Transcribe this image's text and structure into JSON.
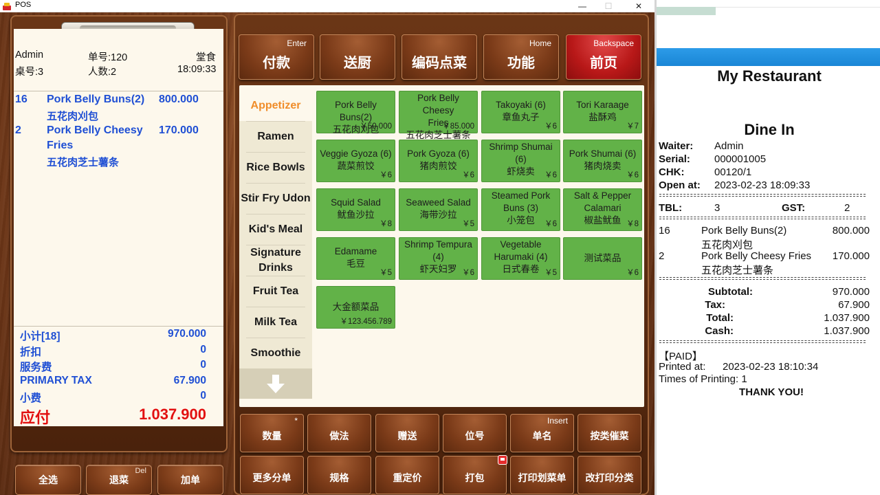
{
  "window": {
    "title": "POS",
    "minimize": "—",
    "maximize": "☐",
    "close": "✕"
  },
  "order_header": {
    "operator": "Admin",
    "order_no": "单号:120",
    "mode": "堂食",
    "table": "桌号:3",
    "guests": "人数:2",
    "time": "18:09:33"
  },
  "order_items": [
    {
      "qty": "16",
      "name": "Pork Belly Buns(2)",
      "name_cn": "五花肉刈包",
      "price": "800.000"
    },
    {
      "qty": "2",
      "name_line1": "Pork Belly Cheesy",
      "name_line2": "Fries",
      "name_cn": "五花肉芝士薯条",
      "price": "170.000"
    }
  ],
  "summary": {
    "subtotal_label": "小计[18]",
    "subtotal": "970.000",
    "discount_label": "折扣",
    "discount": "0",
    "service_label": "服务费",
    "service": "0",
    "tax_label": "PRIMARY TAX",
    "tax": "67.900",
    "tip_label": "小费",
    "tip": "0",
    "due_label": "应付",
    "due": "1.037.900"
  },
  "left_buttons": [
    {
      "label": "全选",
      "hotkey": ""
    },
    {
      "label": "退菜",
      "hotkey": "Del"
    },
    {
      "label": "加单",
      "hotkey": ""
    }
  ],
  "top_buttons": [
    {
      "label": "付款",
      "hotkey": "Enter"
    },
    {
      "label": "送厨",
      "hotkey": ""
    },
    {
      "label": "编码点菜",
      "hotkey": ""
    },
    {
      "label": "功能",
      "hotkey": "Home"
    },
    {
      "label": "前页",
      "hotkey": "Backspace"
    }
  ],
  "categories": [
    {
      "label": "Appetizer",
      "active": true
    },
    {
      "label": "Ramen"
    },
    {
      "label": "Rice Bowls"
    },
    {
      "label": "Stir Fry Udon"
    },
    {
      "label": "Kid's Meal"
    },
    {
      "label": "Signature Drinks"
    },
    {
      "label": "Fruit Tea"
    },
    {
      "label": "Milk Tea"
    },
    {
      "label": "Smoothie"
    }
  ],
  "dishes": [
    {
      "l1": "Pork Belly Buns(2)",
      "l2": "五花肉刈包",
      "l3": "",
      "price": "￥50.000"
    },
    {
      "l1": "Pork Belly Cheesy",
      "l2": "Fries",
      "l3": "五花肉芝士薯条",
      "price": "￥85.000"
    },
    {
      "l1": "Takoyaki (6)",
      "l2": "章鱼丸子",
      "l3": "",
      "price": "￥6"
    },
    {
      "l1": "Tori Karaage",
      "l2": "盐酥鸡",
      "l3": "",
      "price": "￥7"
    },
    {
      "l1": "Veggie Gyoza (6)",
      "l2": "蔬菜煎饺",
      "l3": "",
      "price": "￥6"
    },
    {
      "l1": "Pork Gyoza (6)",
      "l2": "猪肉煎饺",
      "l3": "",
      "price": "￥6"
    },
    {
      "l1": "Shrimp Shumai",
      "l2": "(6)",
      "l3": "虾烧卖",
      "price": "￥6"
    },
    {
      "l1": "Pork Shumai (6)",
      "l2": "猪肉烧卖",
      "l3": "",
      "price": "￥6"
    },
    {
      "l1": "Squid Salad",
      "l2": "鱿鱼沙拉",
      "l3": "",
      "price": "￥8"
    },
    {
      "l1": "Seaweed Salad",
      "l2": "海带沙拉",
      "l3": "",
      "price": "￥5"
    },
    {
      "l1": "Steamed Pork",
      "l2": "Buns (3)",
      "l3": "小笼包",
      "price": "￥6"
    },
    {
      "l1": "Salt & Pepper",
      "l2": "Calamari",
      "l3": "椒盐鱿鱼",
      "price": "￥8"
    },
    {
      "l1": "Edamame",
      "l2": "毛豆",
      "l3": "",
      "price": "￥5"
    },
    {
      "l1": "Shrimp Tempura",
      "l2": "(4)",
      "l3": "虾天妇罗",
      "price": "￥6"
    },
    {
      "l1": "Vegetable",
      "l2": "Harumaki (4)",
      "l3": "日式春卷",
      "price": "￥5"
    },
    {
      "l1": "测试菜品",
      "l2": "",
      "l3": "",
      "price": "￥6"
    },
    {
      "l1": "大金额菜品",
      "l2": "",
      "l3": "",
      "price": "￥123.456.789"
    }
  ],
  "bottom_buttons": [
    {
      "label": "数量",
      "hotkey": "*"
    },
    {
      "label": "做法",
      "hotkey": ""
    },
    {
      "label": "赠送",
      "hotkey": ""
    },
    {
      "label": "位号",
      "hotkey": ""
    },
    {
      "label": "单名",
      "hotkey": "Insert"
    },
    {
      "label": "按类催菜",
      "hotkey": ""
    },
    {
      "label": "更多分单",
      "hotkey": ""
    },
    {
      "label": "规格",
      "hotkey": ""
    },
    {
      "label": "重定价",
      "hotkey": ""
    },
    {
      "label": "打包",
      "hotkey": ""
    },
    {
      "label": "打印划菜单",
      "hotkey": ""
    },
    {
      "label": "改打印分类",
      "hotkey": ""
    }
  ],
  "receipt": {
    "restaurant": "My Restaurant",
    "mode": "Dine In",
    "waiter_label": "Waiter:",
    "waiter": "Admin",
    "serial_label": "Serial:",
    "serial": "000001005",
    "chk_label": "CHK:",
    "chk": "00120/1",
    "open_label": "Open at:",
    "open": "2023-02-23 18:09:33",
    "tbl_label": "TBL:",
    "tbl": "3",
    "gst_label": "GST:",
    "gst": "2",
    "items": [
      {
        "qty": "16",
        "name": "Pork Belly Buns(2)",
        "price": "800.000",
        "cn": "五花肉刈包"
      },
      {
        "qty": "2",
        "name": "Pork Belly Cheesy Fries",
        "price": "170.000",
        "cn": "五花肉芝士薯条"
      }
    ],
    "subtotal_label": "Subtotal:",
    "subtotal": "970.000",
    "tax_label": "Tax:",
    "tax": "67.900",
    "total_label": "Total:",
    "total": "1.037.900",
    "cash_label": "Cash:",
    "cash": "1.037.900",
    "paid": "【PAID】",
    "printed_label": "Printed at:",
    "printed": "2023-02-23 18:10:34",
    "times": "Times of Printing: 1",
    "thanks": "THANK YOU!"
  },
  "colors": {
    "accent_blue": "#1f4fd4",
    "due_red": "#e21010",
    "dish_green": "#62b248",
    "active_orange": "#f08d2a"
  }
}
